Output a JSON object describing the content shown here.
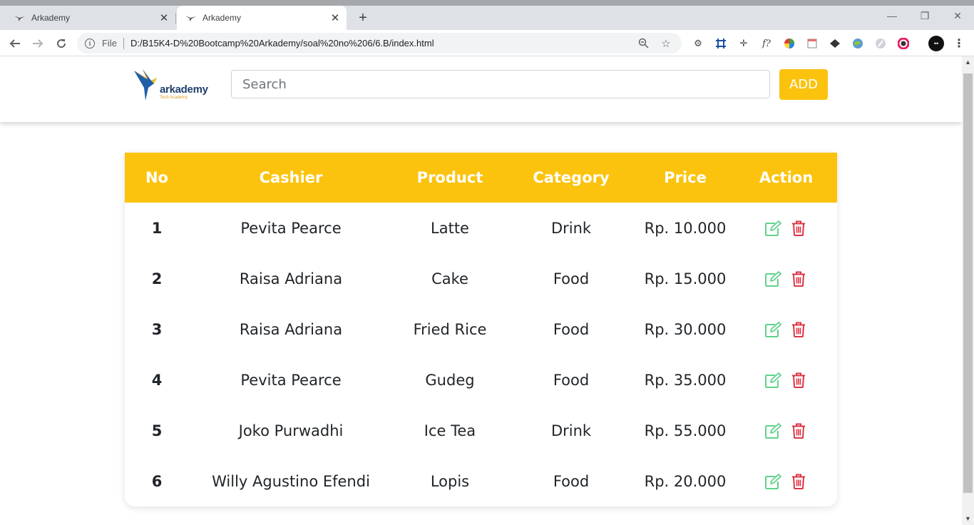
{
  "browser": {
    "tabs": [
      {
        "title": "Arkademy",
        "active": false
      },
      {
        "title": "Arkademy",
        "active": true
      }
    ],
    "new_tab": "+",
    "window_controls": {
      "minimize": "—",
      "restore": "❐",
      "close": "✕"
    },
    "address": {
      "scheme": "File",
      "url": "D:/B15K4-D%20Bootcamp%20Arkademy/soal%20no%206/6.B/index.html"
    }
  },
  "header": {
    "logo_text": "arkademy",
    "logo_subtext": "Tech Academy",
    "search_placeholder": "Search",
    "add_label": "ADD"
  },
  "table": {
    "columns": [
      "No",
      "Cashier",
      "Product",
      "Category",
      "Price",
      "Action"
    ],
    "rows": [
      {
        "no": "1",
        "cashier": "Pevita Pearce",
        "product": "Latte",
        "category": "Drink",
        "price": "Rp. 10.000"
      },
      {
        "no": "2",
        "cashier": "Raisa Adriana",
        "product": "Cake",
        "category": "Food",
        "price": "Rp. 15.000"
      },
      {
        "no": "3",
        "cashier": "Raisa Adriana",
        "product": "Fried Rice",
        "category": "Food",
        "price": "Rp. 30.000"
      },
      {
        "no": "4",
        "cashier": "Pevita Pearce",
        "product": "Gudeg",
        "category": "Food",
        "price": "Rp. 35.000"
      },
      {
        "no": "5",
        "cashier": "Joko Purwadhi",
        "product": "Ice Tea",
        "category": "Drink",
        "price": "Rp. 55.000"
      },
      {
        "no": "6",
        "cashier": "Willy Agustino Efendi",
        "product": "Lopis",
        "category": "Food",
        "price": "Rp. 20.000"
      }
    ],
    "row_actions": [
      {
        "icon": "edit-icon",
        "color": "#5fd38a"
      },
      {
        "icon": "trash-icon",
        "color": "#dc3545"
      }
    ]
  },
  "colors": {
    "accent": "#fbc30e",
    "edit": "#5fd38a",
    "delete": "#dc3545",
    "brand_blue": "#1f3f6d"
  }
}
